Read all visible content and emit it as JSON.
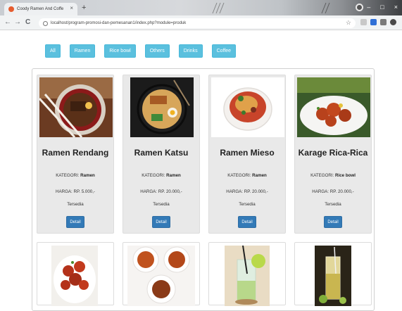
{
  "browser": {
    "tab_title": "Coody Ramen And Coffe",
    "tab_close": "×",
    "new_tab": "+",
    "url": "localhost/program-promosi-dan-pemesanan1/index.php?module=produk",
    "back": "←",
    "forward": "→",
    "reload": "C",
    "star": "☆",
    "minimize": "–",
    "maximize": "□",
    "close": "×"
  },
  "filters": [
    "All",
    "Ramen",
    "Rice bowl",
    "Others",
    "Drinks",
    "Coffee"
  ],
  "colors": {
    "filter": "#5bc0de",
    "detail": "#337ab7",
    "card": "#e9e9e9"
  },
  "products": [
    {
      "name": "Ramen Rendang",
      "kategori_label": "KATEGORI:",
      "kategori": "Ramen",
      "harga_label": "HARGA:",
      "harga": "RP. 5.000,-",
      "status": "Tersedia",
      "detail": "Detail",
      "image": "ramen-rendang-bowl"
    },
    {
      "name": "Ramen Katsu",
      "kategori_label": "KATEGORI:",
      "kategori": "Ramen",
      "harga_label": "HARGA:",
      "harga": "RP. 20.000,-",
      "status": "Tersedia",
      "detail": "Detail",
      "image": "ramen-katsu-bowl"
    },
    {
      "name": "Ramen Mieso",
      "kategori_label": "KATEGORI:",
      "kategori": "Ramen",
      "harga_label": "HARGA:",
      "harga": "RP. 20.000,-",
      "status": "Tersedia",
      "detail": "Detail",
      "image": "ramen-mieso-bowl"
    },
    {
      "name": "Karage Rica-Rica",
      "kategori_label": "KATEGORI:",
      "kategori": "Rice bowl",
      "harga_label": "HARGA:",
      "harga": "RP. 20.000,-",
      "status": "Tersedia",
      "detail": "Detail",
      "image": "karage-plate"
    }
  ],
  "second_row_images": [
    "rice-bowl-chicken",
    "three-bowls",
    "drink-lime",
    "iced-drink"
  ]
}
